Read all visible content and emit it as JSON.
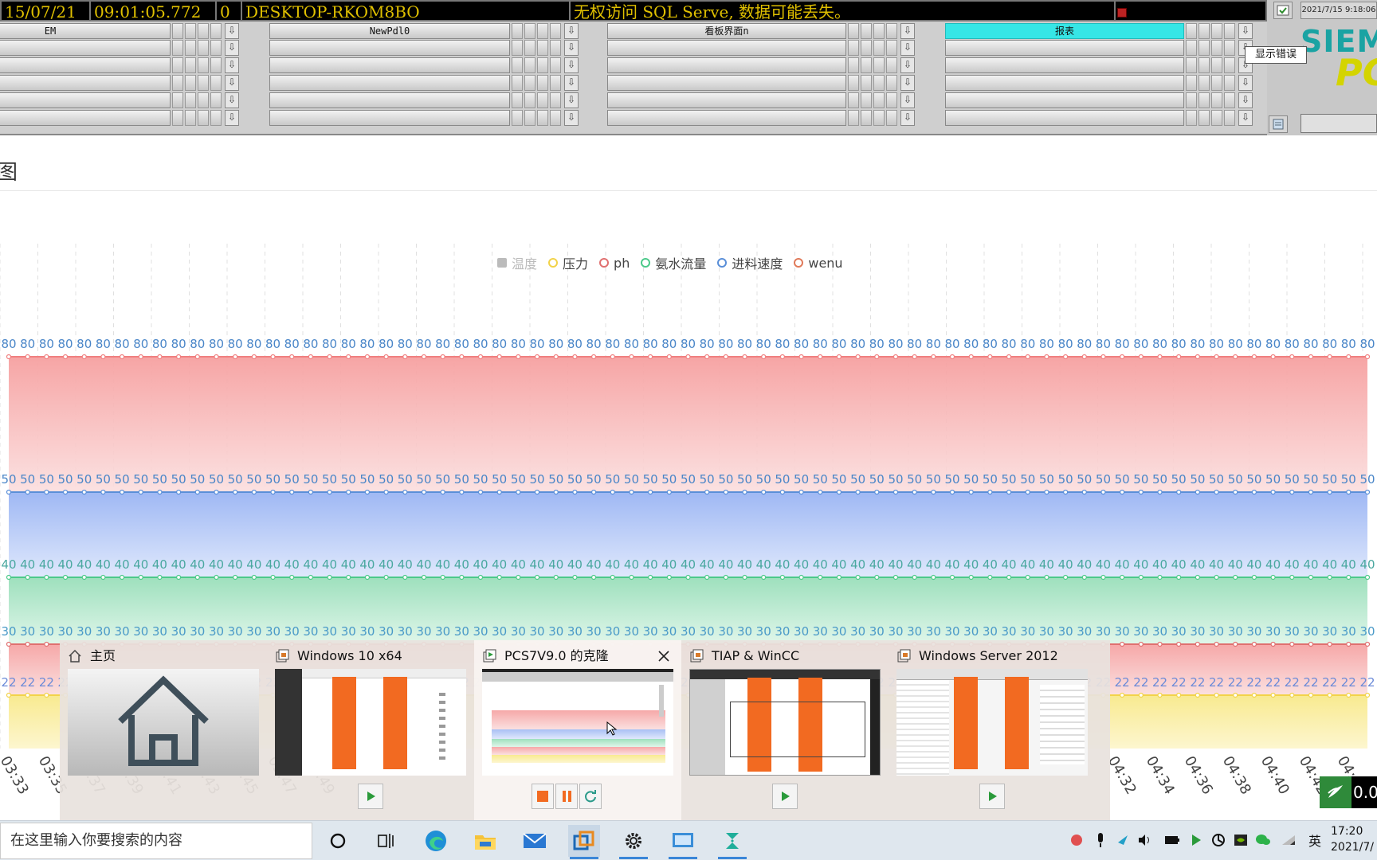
{
  "statusbar": {
    "date": "15/07/21",
    "time": "09:01:05.772",
    "num": "0",
    "host": "DESKTOP-RKOM8BO",
    "message": "无权访问 SQL Serve, 数据可能丢失。",
    "datetime": "2021/7/15 9:18:06"
  },
  "nav": {
    "rows": [
      [
        "EM",
        "NewPdl0",
        "看板界面n",
        "报表"
      ],
      [
        "",
        "",
        "",
        ""
      ],
      [
        "",
        "",
        "",
        ""
      ],
      [
        "",
        "",
        "",
        ""
      ],
      [
        "",
        "",
        "",
        ""
      ],
      [
        "",
        "",
        "",
        ""
      ]
    ],
    "active": "报表",
    "tooltip": "显示错误"
  },
  "brand": {
    "line1": "SIEM",
    "line2": "PC"
  },
  "page": {
    "title": "图"
  },
  "legend": [
    {
      "label": "温度",
      "color": "#bbbbbb",
      "shape": "square"
    },
    {
      "label": "压力",
      "color": "#f2d34a",
      "shape": "circle"
    },
    {
      "label": "ph",
      "color": "#e07070",
      "shape": "circle"
    },
    {
      "label": "氨水流量",
      "color": "#4cc98a",
      "shape": "circle"
    },
    {
      "label": "进料速度",
      "color": "#5a8fd8",
      "shape": "circle"
    },
    {
      "label": "wenu",
      "color": "#e07a5a",
      "shape": "circle"
    }
  ],
  "chart_data": {
    "type": "line",
    "series_style": "stacked-area",
    "points_count": 73,
    "series": [
      {
        "name": "压力",
        "color": "#f2d34a",
        "constant": 22
      },
      {
        "name": "ph",
        "color": "#e07070",
        "constant": 30
      },
      {
        "name": "氨水流量",
        "color": "#4cc98a",
        "constant": 40
      },
      {
        "name": "进料速度",
        "color": "#5a8fd8",
        "constant": 50
      },
      {
        "name": "wenu",
        "color": "#f08080",
        "constant": 80
      }
    ],
    "band_labels": [
      "80",
      "50",
      "40",
      "30",
      "22"
    ],
    "x_labels_visible": [
      "03:33",
      "03:35",
      "03:37",
      "03:39",
      "03:41",
      "03:43",
      "03:45",
      "03:47",
      "03:49",
      "04:32",
      "04:34",
      "04:36",
      "04:38",
      "04:40",
      "04:42",
      "04:44"
    ],
    "grid": true,
    "legend_position": "top-center"
  },
  "popup": {
    "items": [
      {
        "title": "主页",
        "kind": "home"
      },
      {
        "title": "Windows 10 x64",
        "kind": "vm"
      },
      {
        "title": "PCS7V9.0 的克隆",
        "kind": "vm-active"
      },
      {
        "title": "TIAP & WinCC",
        "kind": "vm"
      },
      {
        "title": "Windows Server 2012",
        "kind": "vm"
      }
    ]
  },
  "badge": {
    "value": "0.0"
  },
  "taskbar": {
    "search_placeholder": "在这里输入你要搜索的内容",
    "lang": "英",
    "clock_time": "17:20",
    "clock_date": "2021/7/"
  }
}
